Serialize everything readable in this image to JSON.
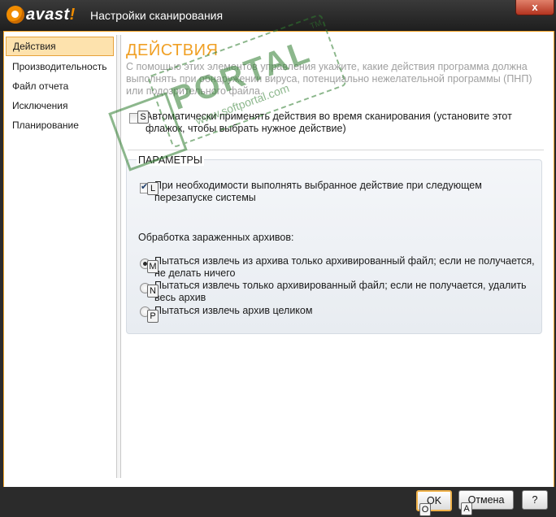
{
  "window": {
    "app_logo": "avast",
    "title": "Настройки сканирования",
    "close_label": "x"
  },
  "sidebar": {
    "items": [
      {
        "label": "Действия",
        "active": true
      },
      {
        "label": "Производительность",
        "active": false
      },
      {
        "label": "Файл отчета",
        "active": false
      },
      {
        "label": "Исключения",
        "active": false
      },
      {
        "label": "Планирование",
        "active": false
      }
    ]
  },
  "main": {
    "heading": "ДЕЙСТВИЯ",
    "description": "С помощью этих элементов управления укажите, какие действия программа должна выполнять при обнаружении вируса, потенциально нежелательной программы (ПНП) или подозрительного файла.",
    "auto_checkbox": {
      "label": "Автоматически применять действия во время сканирования (установите этот флажок, чтобы выбрать нужное действие)",
      "checked": false,
      "hotkey": "S"
    },
    "params": {
      "title": "ПАРАМЕТРЫ",
      "reboot_checkbox": {
        "label": "При необходимости выполнять выбранное действие при следующем перезапуске системы",
        "checked": true,
        "hotkey": "L"
      },
      "archives_label": "Обработка зараженных архивов:",
      "archive_options": [
        {
          "label": "Пытаться извлечь из архива только архивированный файл; если не получается, не делать ничего",
          "selected": true,
          "hotkey": "M"
        },
        {
          "label": "Пытаться извлечь только архивированный файл; если не получается, удалить весь архив",
          "selected": false,
          "hotkey": "N"
        },
        {
          "label": "Пытаться извлечь архив целиком",
          "selected": false,
          "hotkey": "P"
        }
      ]
    }
  },
  "watermark": {
    "text": "PORTAL",
    "trademark": "TM",
    "url": "www.softportal.com"
  },
  "footer": {
    "ok_label": "OK",
    "ok_hotkey": "O",
    "cancel_label": "Отмена",
    "cancel_hotkey": "A",
    "help_label": "?"
  },
  "colors": {
    "accent_orange": "#f0a025",
    "selection_bg": "#fde2ad",
    "title_bar": "#2b2b2b"
  }
}
